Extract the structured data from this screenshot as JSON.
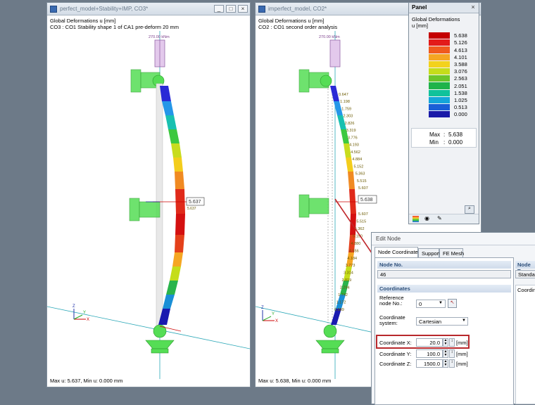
{
  "left_window": {
    "title": "perfect_model+Stability+IMP, CO3*",
    "line1": "Global Deformations u [mm]",
    "line2": "CO3 : CO1 Stability shape 1 of CA1 pre-deform 20 mm",
    "load_label": "270.00 kNm",
    "max_tag": "5.637",
    "max_small": "5.637",
    "status": "Max u: 5.637, Min u: 0.000 mm",
    "minimize": "_",
    "maximize": "□",
    "close": "×"
  },
  "right_window": {
    "title": "imperfect_model, CO2*",
    "line1": "Global Deformations u [mm]",
    "line2": "CO2 : CO1 second order analysis",
    "load_label": "270.00 kNm",
    "max_tag": "5.638",
    "status": "Max u: 5.638, Min u: 0.000 mm",
    "labels_upper": [
      "0.647",
      "1.198",
      "1.759",
      "2.303",
      "2.826",
      "3.319",
      "3.776",
      "4.193",
      "4.562",
      "4.884",
      "5.152",
      "5.363",
      "5.515",
      "5.607"
    ],
    "labels_lower": [
      "5.607",
      "5.515",
      "5.362",
      "5.150",
      "4.880",
      "4.556",
      "4.184",
      "3.773",
      "3.314",
      "2.819",
      "2.294",
      "1.742",
      "1.172",
      "0.589"
    ]
  },
  "panel": {
    "title": "Panel",
    "close": "×",
    "heading1": "Global Deformations",
    "heading2": "u [mm]",
    "legend": [
      {
        "value": "5.638",
        "color": "#c40000"
      },
      {
        "value": "5.126",
        "color": "#e31a1a"
      },
      {
        "value": "4.613",
        "color": "#f05a1e"
      },
      {
        "value": "4.101",
        "color": "#f5a623"
      },
      {
        "value": "3.588",
        "color": "#f3d21c"
      },
      {
        "value": "3.076",
        "color": "#c5dd1b"
      },
      {
        "value": "2.563",
        "color": "#6cc52a"
      },
      {
        "value": "2.051",
        "color": "#1fb34a"
      },
      {
        "value": "1.538",
        "color": "#10c29b"
      },
      {
        "value": "1.025",
        "color": "#15a6d9"
      },
      {
        "value": "0.513",
        "color": "#1a5ed6"
      },
      {
        "value": "0.000",
        "color": "#1a1aa8"
      }
    ],
    "max_label": "Max",
    "max_value": "5.638",
    "min_label": "Min",
    "min_value": "0.000",
    "colon": ":"
  },
  "dialog": {
    "title": "Edit Node",
    "tabs": [
      "Node Coordinates",
      "Support",
      "FE Mesh"
    ],
    "node_no_label": "Node No.",
    "node_no_value": "46",
    "node_type_label": "Node Type",
    "node_type_value": "Standard",
    "coordinates_label": "Coordinates",
    "coordinates_right": "Coordinate",
    "ref_node_label_1": "Reference",
    "ref_node_label_2": "node No.:",
    "ref_node_value": "0",
    "coord_system_label_1": "Coordinate",
    "coord_system_label_2": "system:",
    "coord_system_value": "Cartesian",
    "x_label": "Coordinate X:",
    "x_value": "20.0",
    "y_label": "Coordinate Y:",
    "y_value": "100.0",
    "z_label": "Coordinate Z:",
    "z_value": "1500.0",
    "unit": "[mm]"
  }
}
